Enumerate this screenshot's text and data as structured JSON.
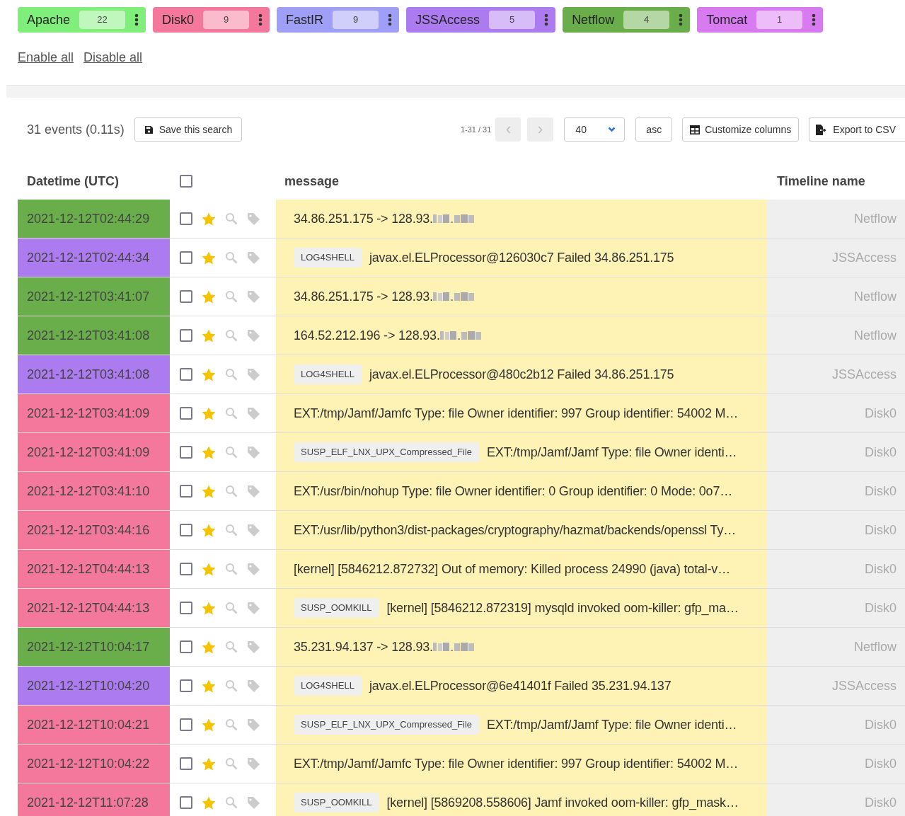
{
  "timelines": [
    {
      "name": "Apache",
      "count": "22",
      "color": "#80ee7a"
    },
    {
      "name": "Disk0",
      "count": "9",
      "color": "#f4789b"
    },
    {
      "name": "FastIR",
      "count": "9",
      "color": "#a09ff8"
    },
    {
      "name": "JSSAccess",
      "count": "5",
      "color": "#ad7bf0"
    },
    {
      "name": "Netflow",
      "count": "4",
      "color": "#6aae4c"
    },
    {
      "name": "Tomcat",
      "count": "1",
      "color": "#d97bf0"
    }
  ],
  "links": [
    "Enable all",
    "Disable all"
  ],
  "toolbar": {
    "summary": "31 events (0.11s)",
    "save_button": "Save this search",
    "range": "1-31 / 31",
    "page_size": "40",
    "order": "asc",
    "customize_button": "Customize columns",
    "export_button": "Export to CSV"
  },
  "table": {
    "columns": [
      "Datetime (UTC)",
      "message",
      "Timeline name"
    ],
    "select_all_checked": false,
    "rows": [
      {
        "datetime": "2021-12-12T02:44:29",
        "color": "#6aae4c",
        "checked": false,
        "starred": true,
        "message": "34.86.251.175 -> 128.93.",
        "redacted": true,
        "timeline": "Netflow"
      },
      {
        "datetime": "2021-12-12T02:44:34",
        "color": "#ad7bf0",
        "checked": false,
        "starred": true,
        "tag": "LOG4SHELL",
        "message": "javax.el.ELProcessor@126030c7 Failed 34.86.251.175",
        "timeline": "JSSAccess"
      },
      {
        "datetime": "2021-12-12T03:41:07",
        "color": "#6aae4c",
        "checked": false,
        "starred": true,
        "message": "34.86.251.175 -> 128.93.",
        "redacted": true,
        "timeline": "Netflow"
      },
      {
        "datetime": "2021-12-12T03:41:08",
        "color": "#6aae4c",
        "checked": false,
        "starred": true,
        "message": "164.52.212.196 -> 128.93.",
        "redacted": true,
        "timeline": "Netflow"
      },
      {
        "datetime": "2021-12-12T03:41:08",
        "color": "#ad7bf0",
        "checked": false,
        "starred": true,
        "tag": "LOG4SHELL",
        "message": "javax.el.ELProcessor@480c2b12 Failed 34.86.251.175",
        "timeline": "JSSAccess"
      },
      {
        "datetime": "2021-12-12T03:41:09",
        "color": "#f4789b",
        "checked": false,
        "starred": true,
        "message": "EXT:/tmp/Jamf/Jamfc Type: file Owner identifier: 997 Group identifier: 54002 M…",
        "timeline": "Disk0"
      },
      {
        "datetime": "2021-12-12T03:41:09",
        "color": "#f4789b",
        "checked": false,
        "starred": true,
        "tag": "SUSP_ELF_LNX_UPX_Compressed_File",
        "message": "EXT:/tmp/Jamf/Jamf Type: file Owner identi…",
        "timeline": "Disk0"
      },
      {
        "datetime": "2021-12-12T03:41:10",
        "color": "#f4789b",
        "checked": false,
        "starred": true,
        "message": "EXT:/usr/bin/nohup Type: file Owner identifier: 0 Group identifier: 0 Mode: 0o7…",
        "timeline": "Disk0"
      },
      {
        "datetime": "2021-12-12T03:44:16",
        "color": "#f4789b",
        "checked": false,
        "starred": true,
        "message": "EXT:/usr/lib/python3/dist-packages/cryptography/hazmat/backends/openssl Ty…",
        "timeline": "Disk0"
      },
      {
        "datetime": "2021-12-12T04:44:13",
        "color": "#f4789b",
        "checked": false,
        "starred": true,
        "message": "[kernel] [5846212.872732] Out of memory: Killed process 24990 (java) total-v…",
        "timeline": "Disk0"
      },
      {
        "datetime": "2021-12-12T04:44:13",
        "color": "#f4789b",
        "checked": false,
        "starred": true,
        "tag": "SUSP_OOMKILL",
        "message": "[kernel] [5846212.872319] mysqld invoked oom-killer: gfp_ma…",
        "timeline": "Disk0"
      },
      {
        "datetime": "2021-12-12T10:04:17",
        "color": "#6aae4c",
        "checked": false,
        "starred": true,
        "message": "35.231.94.137 -> 128.93.",
        "redacted": true,
        "timeline": "Netflow"
      },
      {
        "datetime": "2021-12-12T10:04:20",
        "color": "#ad7bf0",
        "checked": false,
        "starred": true,
        "tag": "LOG4SHELL",
        "message": "javax.el.ELProcessor@6e41401f Failed 35.231.94.137",
        "timeline": "JSSAccess"
      },
      {
        "datetime": "2021-12-12T10:04:21",
        "color": "#f4789b",
        "checked": false,
        "starred": true,
        "tag": "SUSP_ELF_LNX_UPX_Compressed_File",
        "message": "EXT:/tmp/Jamf/Jamf Type: file Owner identi…",
        "timeline": "Disk0"
      },
      {
        "datetime": "2021-12-12T10:04:22",
        "color": "#f4789b",
        "checked": false,
        "starred": true,
        "message": "EXT:/tmp/Jamf/Jamfc Type: file Owner identifier: 997 Group identifier: 54002 M…",
        "timeline": "Disk0"
      },
      {
        "datetime": "2021-12-12T11:07:28",
        "color": "#f4789b",
        "checked": false,
        "starred": true,
        "tag": "SUSP_OOMKILL",
        "message": "[kernel] [5869208.558606] Jamf invoked oom-killer: gfp_mask…",
        "timeline": "Disk0"
      }
    ]
  }
}
